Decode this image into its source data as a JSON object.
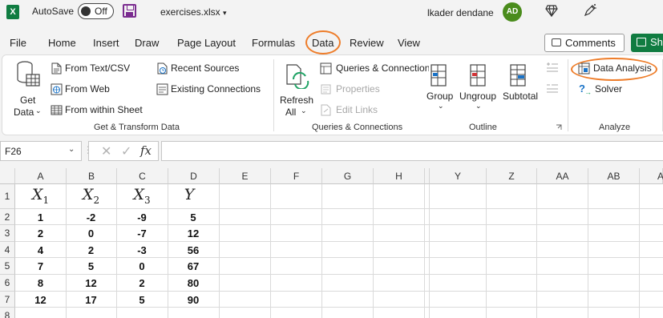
{
  "titlebar": {
    "autosave_label": "AutoSave",
    "autosave_state": "Off",
    "filename": "exercises.xlsx",
    "user_name": "lkader dendane",
    "avatar_initials": "AD"
  },
  "tabs": [
    "File",
    "Home",
    "Insert",
    "Draw",
    "Page Layout",
    "Formulas",
    "Data",
    "Review",
    "View"
  ],
  "header_buttons": {
    "comments": "Comments",
    "share": "Sh"
  },
  "ribbon": {
    "get_data": {
      "line1": "Get",
      "line2": "Data"
    },
    "get_transform": {
      "from_text_csv": "From Text/CSV",
      "from_web": "From Web",
      "from_within_sheet": "From within Sheet",
      "recent_sources": "Recent Sources",
      "existing_connections": "Existing Connections",
      "label": "Get & Transform Data"
    },
    "queries": {
      "refresh_line1": "Refresh",
      "refresh_line2": "All",
      "queries_connections": "Queries & Connections",
      "properties": "Properties",
      "edit_links": "Edit Links",
      "label": "Queries & Connections"
    },
    "outline": {
      "group": "Group",
      "ungroup": "Ungroup",
      "subtotal": "Subtotal",
      "label": "Outline"
    },
    "analyze": {
      "data_analysis": "Data Analysis",
      "solver": "Solver",
      "label": "Analyze"
    }
  },
  "formula_bar": {
    "name_box": "F26",
    "formula": ""
  },
  "columns": [
    "A",
    "B",
    "C",
    "D",
    "E",
    "F",
    "G",
    "H",
    "Y",
    "Z",
    "AA",
    "AB",
    "A"
  ],
  "rows": [
    "1",
    "2",
    "3",
    "4",
    "5",
    "6",
    "7",
    "8"
  ],
  "sheet": {
    "headers": [
      {
        "base": "X",
        "sub": "1"
      },
      {
        "base": "X",
        "sub": "2"
      },
      {
        "base": "X",
        "sub": "3"
      },
      {
        "base": "Y",
        "sub": ""
      }
    ],
    "data": [
      [
        "1",
        "-2",
        "-9",
        "5"
      ],
      [
        "2",
        "0",
        "-7",
        "12"
      ],
      [
        "4",
        "2",
        "-3",
        "56"
      ],
      [
        "7",
        "5",
        "0",
        "67"
      ],
      [
        "8",
        "12",
        "2",
        "80"
      ],
      [
        "12",
        "17",
        "5",
        "90"
      ]
    ]
  },
  "colors": {
    "accent_green": "#107c41",
    "highlight_orange": "#ee7d2a"
  }
}
